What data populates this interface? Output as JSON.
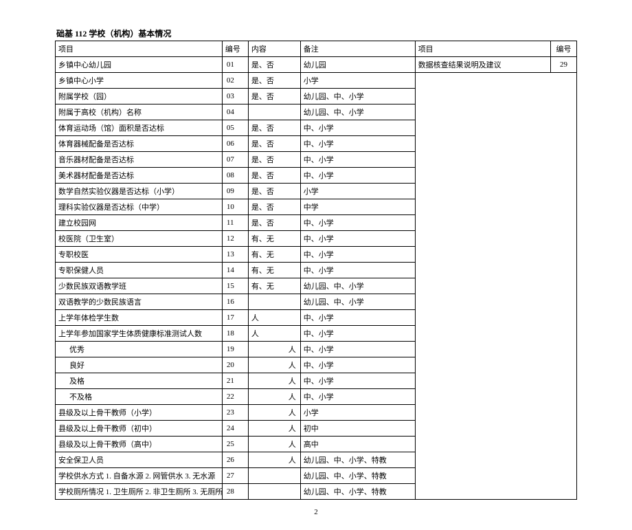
{
  "title": "础基 112 学校（机构）基本情况",
  "header": {
    "item_left": "项目",
    "num_left": "编号",
    "content": "内容",
    "remark": "备注",
    "item_right": "项目",
    "num_right": "编号"
  },
  "right_side": {
    "item": "数据核查结果说明及建议",
    "num": "29"
  },
  "rows": [
    {
      "item": "乡镇中心幼儿园",
      "num": "01",
      "content": "是、否",
      "content_align": "left",
      "remark": "幼儿园",
      "indent": 0
    },
    {
      "item": "乡镇中心小学",
      "num": "02",
      "content": "是、否",
      "content_align": "left",
      "remark": "小学",
      "indent": 0
    },
    {
      "item": "附属学校（园）",
      "num": "03",
      "content": "是、否",
      "content_align": "left",
      "remark": "幼儿园、中、小学",
      "indent": 0
    },
    {
      "item": "附属于高校（机构）名称",
      "num": "04",
      "content": "",
      "content_align": "left",
      "remark": "幼儿园、中、小学",
      "indent": 0
    },
    {
      "item": "体育运动场（馆）面积是否达标",
      "num": "05",
      "content": "是、否",
      "content_align": "left",
      "remark": "中、小学",
      "indent": 0
    },
    {
      "item": "体育器械配备是否达标",
      "num": "06",
      "content": "是、否",
      "content_align": "left",
      "remark": "中、小学",
      "indent": 0
    },
    {
      "item": "音乐器材配备是否达标",
      "num": "07",
      "content": "是、否",
      "content_align": "left",
      "remark": "中、小学",
      "indent": 0
    },
    {
      "item": "美术器材配备是否达标",
      "num": "08",
      "content": "是、否",
      "content_align": "left",
      "remark": "中、小学",
      "indent": 0
    },
    {
      "item": "数学自然实验仪器是否达标（小学）",
      "num": "09",
      "content": "是、否",
      "content_align": "left",
      "remark": "小学",
      "indent": 0
    },
    {
      "item": "理科实验仪器是否达标（中学）",
      "num": "10",
      "content": "是、否",
      "content_align": "left",
      "remark": "中学",
      "indent": 0
    },
    {
      "item": "建立校园网",
      "num": "11",
      "content": "是、否",
      "content_align": "left",
      "remark": "中、小学",
      "indent": 0
    },
    {
      "item": "校医院（卫生室）",
      "num": "12",
      "content": "有、无",
      "content_align": "left",
      "remark": "中、小学",
      "indent": 0
    },
    {
      "item": "专职校医",
      "num": "13",
      "content": "有、无",
      "content_align": "left",
      "remark": "中、小学",
      "indent": 0
    },
    {
      "item": "专职保健人员",
      "num": "14",
      "content": "有、无",
      "content_align": "left",
      "remark": "中、小学",
      "indent": 0
    },
    {
      "item": "少数民族双语教学班",
      "num": "15",
      "content": "有、无",
      "content_align": "left",
      "remark": "幼儿园、中、小学",
      "indent": 0
    },
    {
      "item": "双语教学的少数民族语言",
      "num": "16",
      "content": "",
      "content_align": "left",
      "remark": "幼儿园、中、小学",
      "indent": 0
    },
    {
      "item": "上学年体检学生数",
      "num": "17",
      "content": "人",
      "content_align": "left",
      "remark": "中、小学",
      "indent": 0
    },
    {
      "item": "上学年参加国家学生体质健康标准测试人数",
      "num": "18",
      "content": "人",
      "content_align": "left",
      "remark": "中、小学",
      "indent": 0
    },
    {
      "item": "优秀",
      "num": "19",
      "content": "人",
      "content_align": "right",
      "remark": "中、小学",
      "indent": 1
    },
    {
      "item": "良好",
      "num": "20",
      "content": "人",
      "content_align": "right",
      "remark": "中、小学",
      "indent": 1
    },
    {
      "item": "及格",
      "num": "21",
      "content": "人",
      "content_align": "right",
      "remark": "中、小学",
      "indent": 1
    },
    {
      "item": "不及格",
      "num": "22",
      "content": "人",
      "content_align": "right",
      "remark": "中、小学",
      "indent": 1
    },
    {
      "item": "县级及以上骨干教师（小学）",
      "num": "23",
      "content": "人",
      "content_align": "right",
      "remark": "小学",
      "indent": 0
    },
    {
      "item": "县级及以上骨干教师（初中）",
      "num": "24",
      "content": "人",
      "content_align": "right",
      "remark": "初中",
      "indent": 0
    },
    {
      "item": "县级及以上骨干教师（高中）",
      "num": "25",
      "content": "人",
      "content_align": "right",
      "remark": "高中",
      "indent": 0
    },
    {
      "item": "安全保卫人员",
      "num": "26",
      "content": "人",
      "content_align": "right",
      "remark": "幼儿园、中、小学、特教",
      "indent": 0
    },
    {
      "item": "学校供水方式   1. 自备水源   2. 网管供水    3. 无水源",
      "num": "27",
      "content": "",
      "content_align": "left",
      "remark": "幼儿园、中、小学、特教",
      "indent": 0
    },
    {
      "item": "学校厕所情况   1. 卫生厕所   2. 非卫生厕所  3. 无厕所",
      "num": "28",
      "content": "",
      "content_align": "left",
      "remark": "幼儿园、中、小学、特教",
      "indent": 0
    }
  ],
  "page_number": "2"
}
